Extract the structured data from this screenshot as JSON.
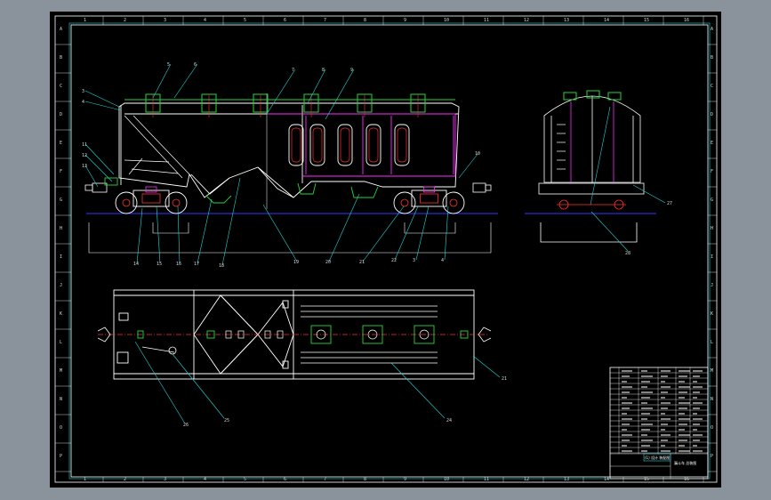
{
  "frame": {
    "row_marks": [
      "A",
      "B",
      "C",
      "D",
      "E",
      "F",
      "G",
      "H",
      "I",
      "J",
      "K",
      "L",
      "M",
      "N",
      "O",
      "P"
    ],
    "col_marks": [
      "1",
      "2",
      "3",
      "4",
      "5",
      "6",
      "7",
      "8",
      "9",
      "10",
      "11",
      "12",
      "13",
      "14",
      "15",
      "16"
    ]
  },
  "callouts": {
    "side_view": [
      "3",
      "4",
      "5",
      "6",
      "7",
      "8",
      "9",
      "10",
      "11",
      "12",
      "13",
      "14",
      "15",
      "16",
      "17",
      "18",
      "19",
      "20",
      "21",
      "22"
    ],
    "plan_view": [
      "21",
      "24",
      "25",
      "26"
    ],
    "end_view": [
      "27",
      "28"
    ]
  },
  "title_block": {
    "caption": "(1) 设计 装配图",
    "drawing_title": "漏斗车 总装图"
  },
  "colors": {
    "background": "#000000",
    "frame": "#ffffff",
    "body": "#ffffff",
    "detail": "#ff3030",
    "green": "#27d43a",
    "magenta": "#ff2bff",
    "blue": "#2f3cff",
    "cyan": "#1fd6d6",
    "yellow": "#e6e640"
  }
}
